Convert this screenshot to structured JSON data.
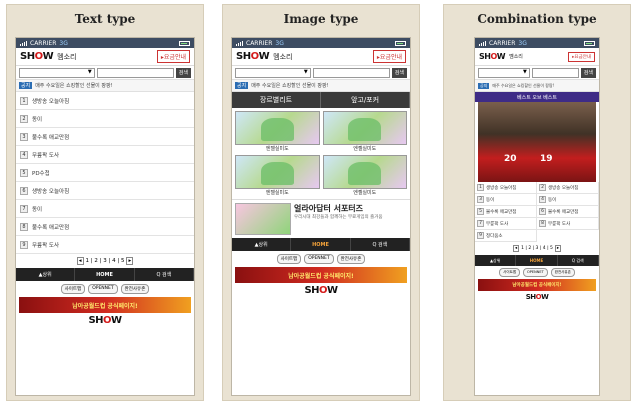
{
  "panels": {
    "text": {
      "title": "Text type"
    },
    "image": {
      "title": "Image type"
    },
    "combo": {
      "title": "Combination type"
    }
  },
  "common": {
    "carrier": "CARRIER",
    "network": "3G",
    "logo": "SHOW",
    "brand_sub": "멤소리",
    "plan_button": "▸요금안내",
    "search_button": "검색",
    "notice_tag": "공지",
    "notice_text": "매주 수요일은 쇼킹할인 선물이 팡팡!",
    "menu": {
      "up": "▲상위",
      "home": "HOME",
      "search": "Q 검색"
    },
    "links": [
      "사이트맵",
      "OPENNET",
      "완전사유존"
    ],
    "banner": "남아공월드컵 공식페이지!",
    "footer_logo": "SHOW"
  },
  "text_type": {
    "items": [
      {
        "num": "1",
        "label": "생방송 오늘아침"
      },
      {
        "num": "2",
        "label": "동이"
      },
      {
        "num": "3",
        "label": "불수록 애교만점"
      },
      {
        "num": "4",
        "label": "무릎팍 도사"
      },
      {
        "num": "5",
        "label": "PD수첩"
      },
      {
        "num": "6",
        "label": "생방송 오늘아침"
      },
      {
        "num": "7",
        "label": "동이"
      },
      {
        "num": "8",
        "label": "불수록 애교만점"
      },
      {
        "num": "9",
        "label": "무릎팍 도사"
      }
    ],
    "pager": "1 | 2 | 3 | 4 | 5"
  },
  "image_type": {
    "tabs": [
      "장르별리트",
      "앞고/포커"
    ],
    "thumbs": [
      "엔젤실미도",
      "엔젤실미도",
      "엔젤실미도",
      "엔젤실미도"
    ],
    "promo_title": "얼라아답터 서포터즈",
    "promo_sub": "우리시대 최강들과 함께하는 무료게임의 즐거움"
  },
  "combo_type": {
    "header": "베스트 오브 베스트",
    "photo_numbers": [
      "20",
      "19"
    ],
    "items": [
      {
        "num": "1",
        "label": "생방송 오늘아침"
      },
      {
        "num": "2",
        "label": "생방송 오늘아침"
      },
      {
        "num": "3",
        "label": "동이"
      },
      {
        "num": "4",
        "label": "동이"
      },
      {
        "num": "5",
        "label": "불수록 애교만점"
      },
      {
        "num": "6",
        "label": "불수록 애교만점"
      },
      {
        "num": "7",
        "label": "무릎팍 도사"
      },
      {
        "num": "8",
        "label": "무릎팍 도사"
      },
      {
        "num": "9",
        "label": "정다움소"
      }
    ],
    "pager": "1 | 2 | 3 | 4 | 5"
  }
}
